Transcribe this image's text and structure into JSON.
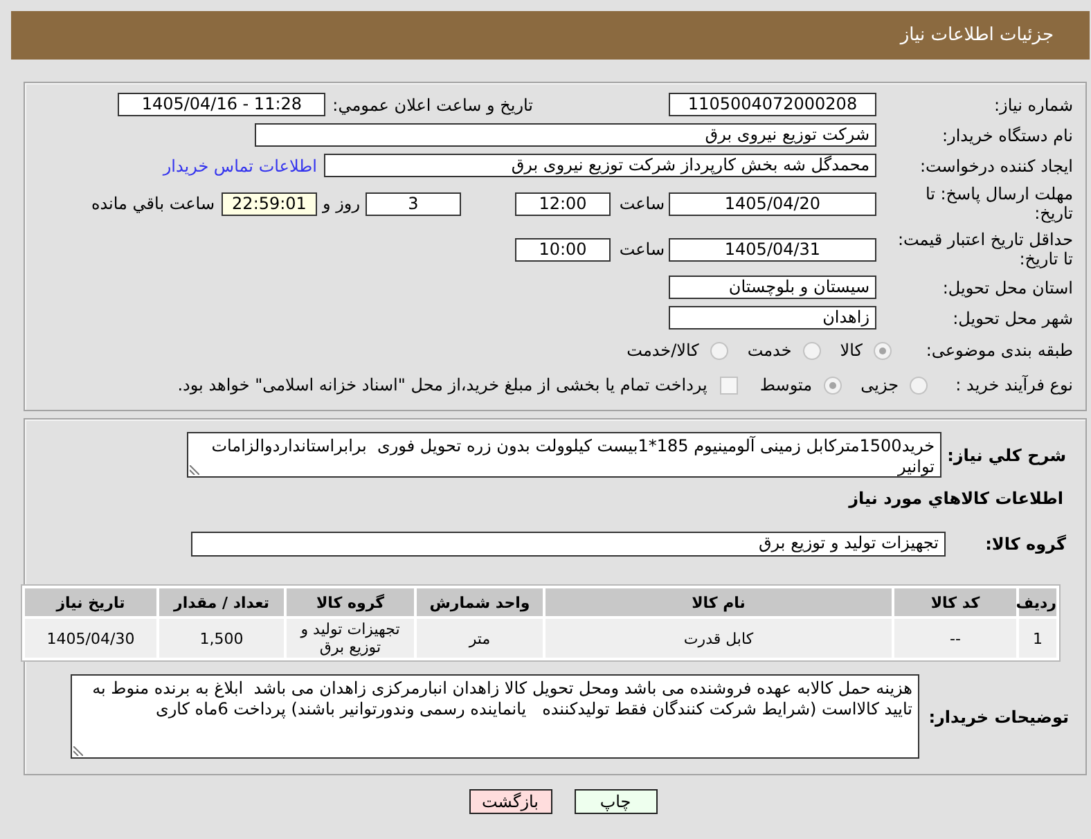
{
  "header": {
    "title": "جزئیات اطلاعات نیاز"
  },
  "need_number": {
    "label": "شماره نیاز:",
    "value": "1105004072000208"
  },
  "announcement": {
    "label": "تاریخ و ساعت اعلان عمومي:",
    "value": "1405/04/16 - 11:28"
  },
  "buyer_org": {
    "label": "نام دستگاه خریدار:",
    "value": "شرکت توزیع نیروی برق"
  },
  "requester": {
    "label": "ایجاد کننده درخواست:",
    "value": "محمدگل شه بخش کارپرداز شرکت توزیع نیروی برق",
    "contact_link": "اطلاعات تماس خریدار"
  },
  "reply_deadline": {
    "label": "مهلت ارسال پاسخ: تا تاریخ:",
    "date": "1405/04/20",
    "time_label": "ساعت",
    "time": "12:00",
    "days": "3",
    "days_label": "روز و",
    "remaining": "22:59:01",
    "remaining_label": "ساعت باقي مانده"
  },
  "price_validity": {
    "label": "حداقل تاریخ اعتبار قیمت: تا تاریخ:",
    "date": "1405/04/31",
    "time_label": "ساعت",
    "time": "10:00"
  },
  "delivery_province": {
    "label": "استان محل تحویل:",
    "value": "سیستان و بلوچستان"
  },
  "delivery_city": {
    "label": "شهر محل تحویل:",
    "value": "زاهدان"
  },
  "subject_category": {
    "label": "طبقه بندی موضوعی:",
    "options": [
      {
        "label": "کالا",
        "selected": true
      },
      {
        "label": "خدمت",
        "selected": false
      },
      {
        "label": "کالا/خدمت",
        "selected": false
      }
    ]
  },
  "purchase_process": {
    "label": "نوع فرآیند خرید :",
    "options": [
      {
        "label": "جزیی",
        "selected": false
      },
      {
        "label": "متوسط",
        "selected": true
      }
    ],
    "treasury_payment": {
      "label": "پرداخت تمام یا بخشی از مبلغ خرید،از محل \"اسناد خزانه اسلامی\" خواهد بود.",
      "checked": false
    }
  },
  "description": {
    "label": "شرح كلي نیاز:",
    "value": "خرید1500مترکابل زمینی آلومینیوم 185*1بیست کیلوولت بدون زره تحویل فوری  برابراستانداردوالزامات توانیر"
  },
  "goods_section_title": "اطلاعات كالاهاي مورد نیاز",
  "goods_group": {
    "label": "گروه کالا:",
    "value": "تجهیزات تولید و توزیع برق"
  },
  "goods_table": {
    "columns": [
      "ردیف",
      "کد کالا",
      "نام کالا",
      "واحد شمارش",
      "گروه کالا",
      "تعداد / مقدار",
      "تاریخ نیاز"
    ],
    "rows": [
      [
        "1",
        "--",
        "کابل قدرت",
        "متر",
        "تجهیزات تولید و توزیع برق",
        "1,500",
        "1405/04/30"
      ]
    ]
  },
  "buyer_notes": {
    "label": "توضیحات خریدار:",
    "value": "هزینه حمل کالابه عهده فروشنده می باشد ومحل تحویل کالا زاهدان انبارمرکزی زاهدان می باشد  ابلاغ به برنده منوط به تایید کالااست (شرایط شرکت کنندگان فقط تولیدکننده   یانماینده رسمی وندورتوانیر باشند) پرداخت 6ماه کاری"
  },
  "buttons": [
    {
      "kind": "print",
      "label": "چاپ"
    },
    {
      "kind": "back",
      "label": "بازگشت"
    }
  ]
}
